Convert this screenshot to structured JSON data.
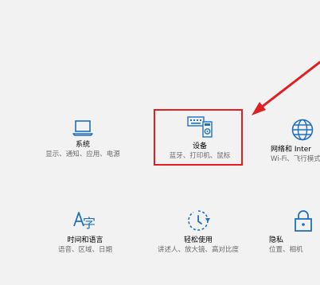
{
  "tiles": {
    "system": {
      "title": "系统",
      "desc": "显示、通知、应用、电源",
      "icon": "laptop-icon"
    },
    "devices": {
      "title": "设备",
      "desc": "蓝牙、打印机、鼠标",
      "icon": "devices-icon"
    },
    "network": {
      "title": "网络和 Inter",
      "desc": "Wi-Fi、飞行模式",
      "icon": "globe-icon"
    },
    "time": {
      "title": "时间和语言",
      "desc": "语音、区域、日期",
      "icon": "time-language-icon"
    },
    "ease": {
      "title": "轻松使用",
      "desc": "讲述人、放大镜、高对比度",
      "icon": "ease-of-access-icon"
    },
    "privacy": {
      "title": "隐私",
      "desc": "位置、相机",
      "icon": "lock-icon"
    }
  },
  "colors": {
    "accent": "#1f6fbf",
    "highlight": "#e02020",
    "background": "#f2f2f2"
  }
}
